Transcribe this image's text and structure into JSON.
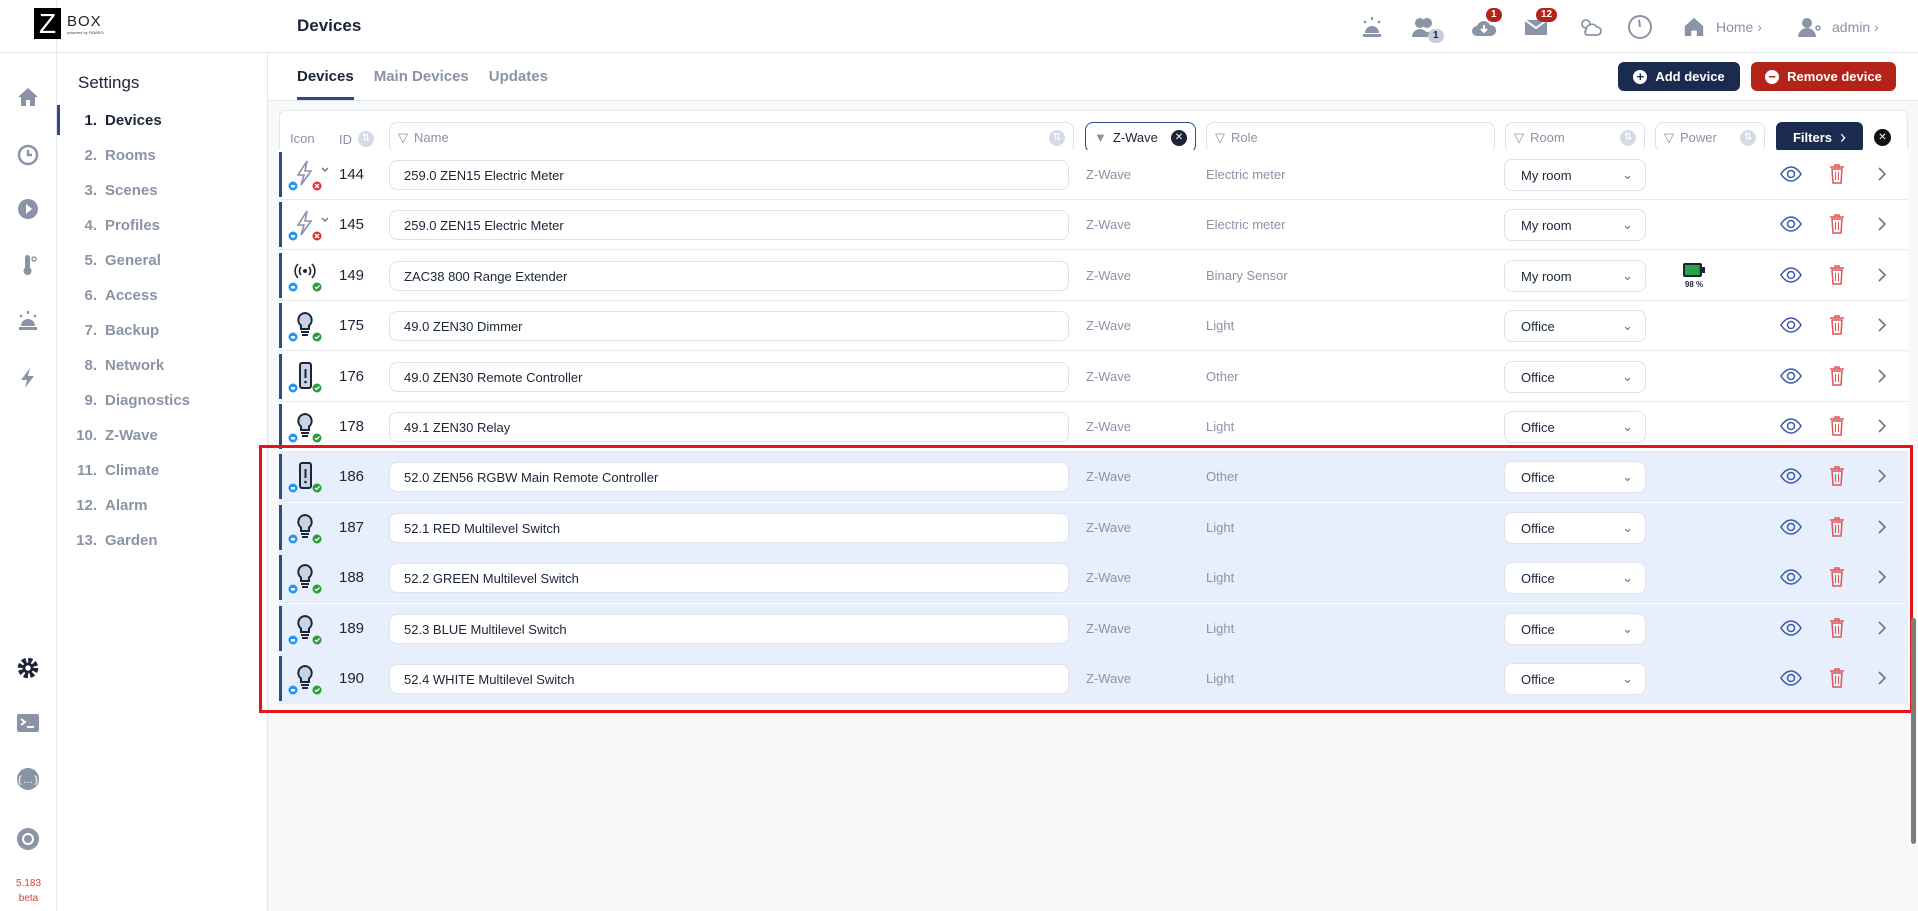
{
  "app": {
    "logo_letter": "Z",
    "logo_word": "BOX",
    "logo_sub": "powered by FIBARO",
    "version": "5.183",
    "version_tag": "beta"
  },
  "header": {
    "title": "Devices",
    "users_badge": "1",
    "updates_badge": "1",
    "messages_badge": "12",
    "home_label": "Home",
    "user_label": "admin"
  },
  "sidebar": {
    "title": "Settings",
    "items": [
      {
        "num": "1.",
        "label": "Devices"
      },
      {
        "num": "2.",
        "label": "Rooms"
      },
      {
        "num": "3.",
        "label": "Scenes"
      },
      {
        "num": "4.",
        "label": "Profiles"
      },
      {
        "num": "5.",
        "label": "General"
      },
      {
        "num": "6.",
        "label": "Access"
      },
      {
        "num": "7.",
        "label": "Backup"
      },
      {
        "num": "8.",
        "label": "Network"
      },
      {
        "num": "9.",
        "label": "Diagnostics"
      },
      {
        "num": "10.",
        "label": "Z-Wave"
      },
      {
        "num": "11.",
        "label": "Climate"
      },
      {
        "num": "12.",
        "label": "Alarm"
      },
      {
        "num": "13.",
        "label": "Garden"
      }
    ]
  },
  "tabs": [
    {
      "label": "Devices"
    },
    {
      "label": "Main Devices"
    },
    {
      "label": "Updates"
    }
  ],
  "actions": {
    "add": "Add device",
    "remove": "Remove device"
  },
  "colors": {
    "accent": "#1b2b4f",
    "danger": "#b42318",
    "selected_row": "#e8effc",
    "highlight": "#e3141b"
  },
  "table": {
    "col_icon": "Icon",
    "col_id": "ID",
    "filters": {
      "name": "Name",
      "protocol": "Z-Wave",
      "role": "Role",
      "room": "Room",
      "power": "Power",
      "filters_btn": "Filters"
    },
    "rows": [
      {
        "icon": "lightning-icon",
        "status": "error",
        "expand": true,
        "id": "144",
        "name": "259.0 ZEN15 Electric Meter",
        "protocol": "Z-Wave",
        "role": "Electric meter",
        "room": "My room",
        "power": "",
        "selected": false
      },
      {
        "icon": "lightning-icon",
        "status": "error",
        "expand": true,
        "id": "145",
        "name": "259.0 ZEN15 Electric Meter",
        "protocol": "Z-Wave",
        "role": "Electric meter",
        "room": "My room",
        "power": "",
        "selected": false
      },
      {
        "icon": "signal-icon",
        "status": "ok",
        "expand": false,
        "id": "149",
        "name": "ZAC38 800 Range Extender",
        "protocol": "Z-Wave",
        "role": "Binary Sensor",
        "room": "My room",
        "power": "98 %",
        "battery": 98,
        "selected": false
      },
      {
        "icon": "bulb-icon",
        "status": "ok",
        "expand": false,
        "id": "175",
        "name": "49.0 ZEN30 Dimmer",
        "protocol": "Z-Wave",
        "role": "Light",
        "room": "Office",
        "power": "",
        "selected": false
      },
      {
        "icon": "remote-icon",
        "status": "ok",
        "expand": false,
        "id": "176",
        "name": "49.0 ZEN30 Remote Controller",
        "protocol": "Z-Wave",
        "role": "Other",
        "room": "Office",
        "power": "",
        "selected": false
      },
      {
        "icon": "bulb-icon",
        "status": "ok",
        "expand": false,
        "id": "178",
        "name": "49.1 ZEN30 Relay",
        "protocol": "Z-Wave",
        "role": "Light",
        "room": "Office",
        "power": "",
        "selected": false
      },
      {
        "icon": "remote-icon",
        "status": "ok",
        "expand": false,
        "id": "186",
        "name": "52.0 ZEN56 RGBW Main Remote Controller",
        "protocol": "Z-Wave",
        "role": "Other",
        "room": "Office",
        "power": "",
        "selected": true
      },
      {
        "icon": "bulb-icon",
        "status": "ok",
        "expand": false,
        "id": "187",
        "name": "52.1 RED Multilevel Switch",
        "protocol": "Z-Wave",
        "role": "Light",
        "room": "Office",
        "power": "",
        "selected": true
      },
      {
        "icon": "bulb-icon",
        "status": "ok",
        "expand": false,
        "id": "188",
        "name": "52.2 GREEN Multilevel Switch",
        "protocol": "Z-Wave",
        "role": "Light",
        "room": "Office",
        "power": "",
        "selected": true
      },
      {
        "icon": "bulb-icon",
        "status": "ok",
        "expand": false,
        "id": "189",
        "name": "52.3 BLUE Multilevel Switch",
        "protocol": "Z-Wave",
        "role": "Light",
        "room": "Office",
        "power": "",
        "selected": true
      },
      {
        "icon": "bulb-icon",
        "status": "ok",
        "expand": false,
        "id": "190",
        "name": "52.4 WHITE Multilevel Switch",
        "protocol": "Z-Wave",
        "role": "Light",
        "room": "Office",
        "power": "",
        "selected": true
      }
    ]
  }
}
